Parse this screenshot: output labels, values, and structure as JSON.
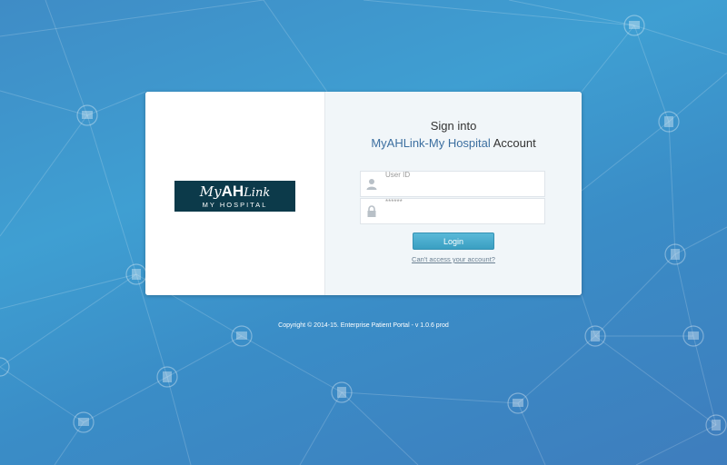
{
  "login": {
    "heading_line1": "Sign into",
    "heading_brand": "MyAHLink-My Hospital",
    "heading_suffix": "Account",
    "user_id_placeholder": "User ID",
    "password_placeholder": "******",
    "login_button": "Login",
    "help_link": "Can't access your account?"
  },
  "logo": {
    "my": "My",
    "ah": "AH",
    "link": "Link",
    "subtitle": "MY HOSPITAL"
  },
  "icons": {
    "user_field": "user-icon",
    "password_field": "lock-icon",
    "background": "hospital-building-icon"
  },
  "colors": {
    "background": "#3f9fd2",
    "logo_bg": "#0c3a4a",
    "brand_text": "#3c6fa0",
    "button": "#4aaed0"
  },
  "footer": {
    "copyright": "Copyright © 2014-15. Enterprise Patient Portal - v 1.0.6 prod"
  }
}
